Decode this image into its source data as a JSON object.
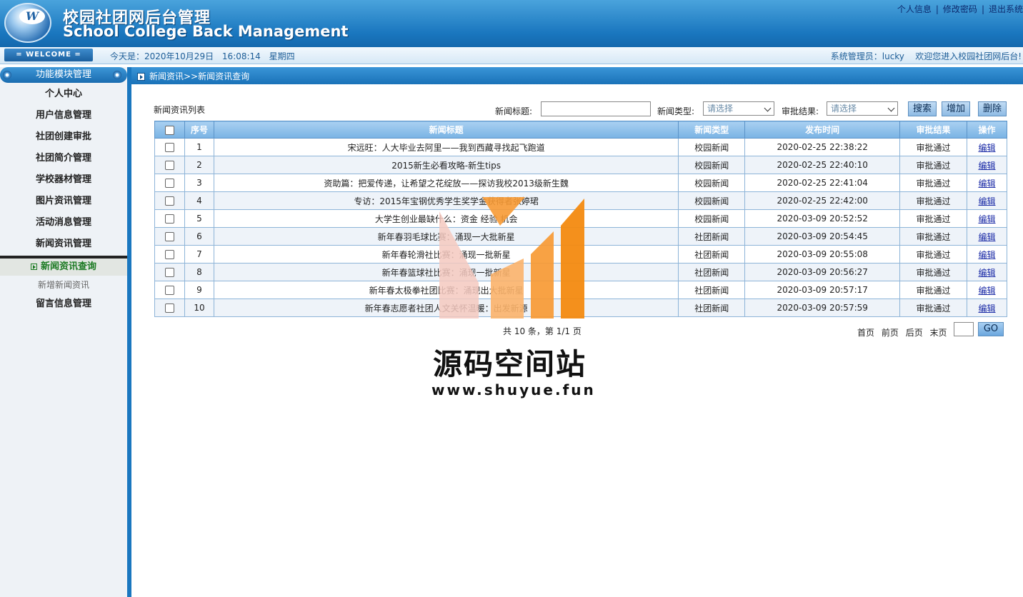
{
  "header": {
    "title_cn": "校园社团网后台管理",
    "title_en": "School College Back Management",
    "logo_letter": "W",
    "links": [
      "个人信息",
      "修改密码",
      "退出系统"
    ]
  },
  "welcome_bar": {
    "welcome": "= WELCOME =",
    "date": "今天是：2020年10月29日",
    "time": "16:08:14",
    "weekday": "星期四",
    "admin": "系统管理员：lucky",
    "greeting": "欢迎您进入校园社团网后台!"
  },
  "sidebar": {
    "header": "功能模块管理",
    "items": [
      "个人中心",
      "用户信息管理",
      "社团创建审批",
      "社团简介管理",
      "学校器材管理",
      "图片资讯管理",
      "活动消息管理",
      "新闻资讯管理"
    ],
    "sub_items": [
      "新闻资讯查询",
      "新增新闻资讯"
    ],
    "after_items": [
      "留言信息管理"
    ]
  },
  "breadcrumb": "新闻资讯>>新闻资讯查询",
  "list": {
    "title": "新闻资讯列表",
    "filters": {
      "title_label": "新闻标题:",
      "type_label": "新闻类型:",
      "type_value": "请选择",
      "result_label": "审批结果:",
      "result_value": "请选择"
    },
    "buttons": {
      "search": "搜索",
      "add": "增加",
      "delete": "删除"
    },
    "columns": [
      "序号",
      "新闻标题",
      "新闻类型",
      "发布时间",
      "审批结果",
      "操作"
    ],
    "rows": [
      {
        "no": "1",
        "title": "宋远旺：人大毕业去阿里——我到西藏寻找起飞跑道",
        "type": "校园新闻",
        "time": "2020-02-25 22:38:22",
        "result": "审批通过",
        "action": "编辑"
      },
      {
        "no": "2",
        "title": "2015新生必看攻略-新生tips",
        "type": "校园新闻",
        "time": "2020-02-25 22:40:10",
        "result": "审批通过",
        "action": "编辑"
      },
      {
        "no": "3",
        "title": "资助篇：把爱传递，让希望之花绽放——探访我校2013级新生魏",
        "type": "校园新闻",
        "time": "2020-02-25 22:41:04",
        "result": "审批通过",
        "action": "编辑"
      },
      {
        "no": "4",
        "title": "专访：2015年宝钢优秀学生奖学金获得者张婷珺",
        "type": "校园新闻",
        "time": "2020-02-25 22:42:00",
        "result": "审批通过",
        "action": "编辑"
      },
      {
        "no": "5",
        "title": "大学生创业最缺什么：资金 经验 机会",
        "type": "校园新闻",
        "time": "2020-03-09 20:52:52",
        "result": "审批通过",
        "action": "编辑"
      },
      {
        "no": "6",
        "title": "新年春羽毛球比赛：涌现一大批新星",
        "type": "社团新闻",
        "time": "2020-03-09 20:54:45",
        "result": "审批通过",
        "action": "编辑"
      },
      {
        "no": "7",
        "title": "新年春轮滑社比赛：涌现一批新星",
        "type": "社团新闻",
        "time": "2020-03-09 20:55:08",
        "result": "审批通过",
        "action": "编辑"
      },
      {
        "no": "8",
        "title": "新年春篮球社比赛：涌现一批新星",
        "type": "社团新闻",
        "time": "2020-03-09 20:56:27",
        "result": "审批通过",
        "action": "编辑"
      },
      {
        "no": "9",
        "title": "新年春太极拳社团比赛：涌现出大批新星",
        "type": "社团新闻",
        "time": "2020-03-09 20:57:17",
        "result": "审批通过",
        "action": "编辑"
      },
      {
        "no": "10",
        "title": "新年春志愿者社团人文关怀温暖：出发新源",
        "type": "社团新闻",
        "time": "2020-03-09 20:57:59",
        "result": "审批通过",
        "action": "编辑"
      }
    ]
  },
  "pager": {
    "summary": "共 10 条，第 1/1 页",
    "links": [
      "首页",
      "前页",
      "后页",
      "末页"
    ],
    "go": "GO"
  },
  "watermark": {
    "text": "源码空间站",
    "url": "www.shuyue.fun",
    "colors": [
      "#f5c9c0",
      "#fbb36a",
      "#f79a34",
      "#f38a10"
    ]
  }
}
